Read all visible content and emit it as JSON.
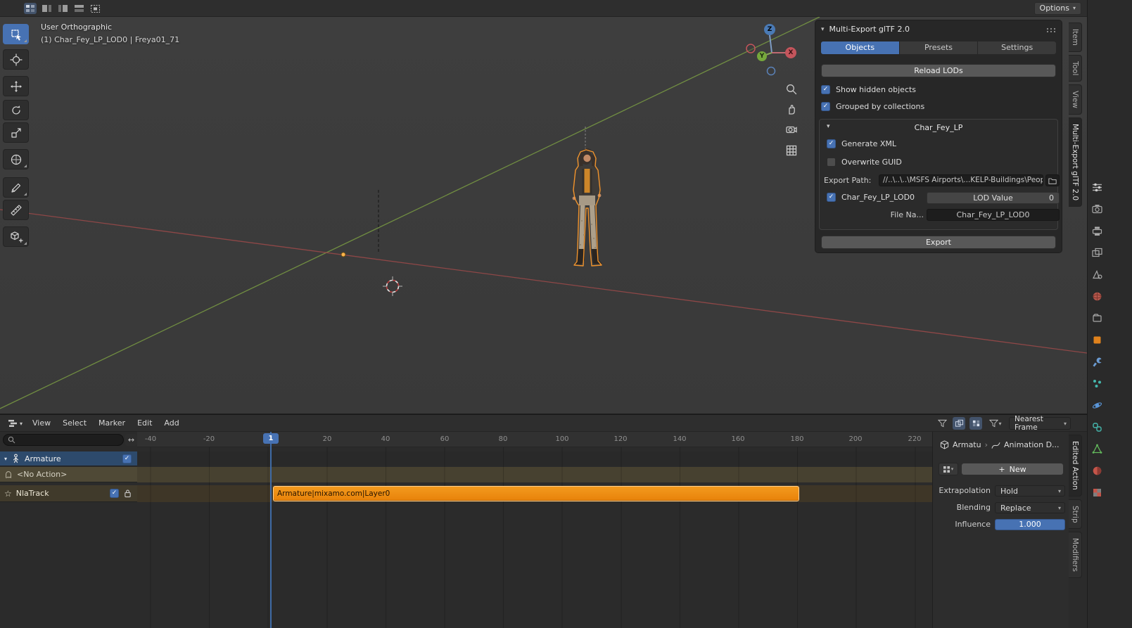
{
  "icons": {
    "check": "✓",
    "down": "▾",
    "bc_sep": "›",
    "star": "☆",
    "swap": "↔",
    "plus": "+"
  },
  "header": {
    "options": "Options"
  },
  "viewport": {
    "view": "User Orthographic",
    "object": "(1) Char_Fey_LP_LOD0 | Freya01_71",
    "gizmo": {
      "x": "X",
      "y": "Y",
      "z": "Z"
    }
  },
  "panel": {
    "title": "Multi-Export glTF 2.0",
    "tabs": [
      "Objects",
      "Presets",
      "Settings"
    ],
    "reload": "Reload LODs",
    "show_hidden": "Show hidden objects",
    "grouped": "Grouped by collections",
    "group_title": "Char_Fey_LP",
    "generate_xml": "Generate XML",
    "overwrite_guid": "Overwrite GUID",
    "export_path_label": "Export Path:",
    "export_path": "//..\\..\\..\\MSFS Airports\\...KELP-Buildings\\People\\",
    "lod_name": "Char_Fey_LP_LOD0",
    "lod_value_label": "LOD Value",
    "lod_value": "0",
    "file_label": "File Na...",
    "file_value": "Char_Fey_LP_LOD0",
    "export": "Export"
  },
  "side_tabs": [
    "Item",
    "Tool",
    "View",
    "Multi-Export glTF 2.0"
  ],
  "nla": {
    "menus": [
      "View",
      "Select",
      "Marker",
      "Edit",
      "Add"
    ],
    "snap": "Nearest Frame",
    "frame": "1",
    "ruler": [
      "-40",
      "-20",
      "20",
      "40",
      "60",
      "80",
      "100",
      "120",
      "140",
      "160",
      "180",
      "200",
      "220"
    ],
    "channels": {
      "armature": "Armature",
      "no_action": "<No Action>",
      "track": "NlaTrack"
    },
    "strip": "Armature|mixamo.com|Layer0",
    "sidebar": {
      "breadcrumb_object": "Armatu",
      "breadcrumb_action": "Animation D...",
      "new_button": "New",
      "extrapolation_label": "Extrapolation",
      "extrapolation": "Hold",
      "blending_label": "Blending",
      "blending": "Replace",
      "influence_label": "Influence",
      "influence": "1.000"
    },
    "tabs": [
      "Edited Action",
      "Strip",
      "Modifiers"
    ]
  },
  "colors": {
    "accent": "#4772b3",
    "strip_orange": "#ef8d10",
    "selection_outline": "#ff9b2d",
    "axis_x": "#9d4a4a",
    "axis_y": "#7a9c43"
  }
}
